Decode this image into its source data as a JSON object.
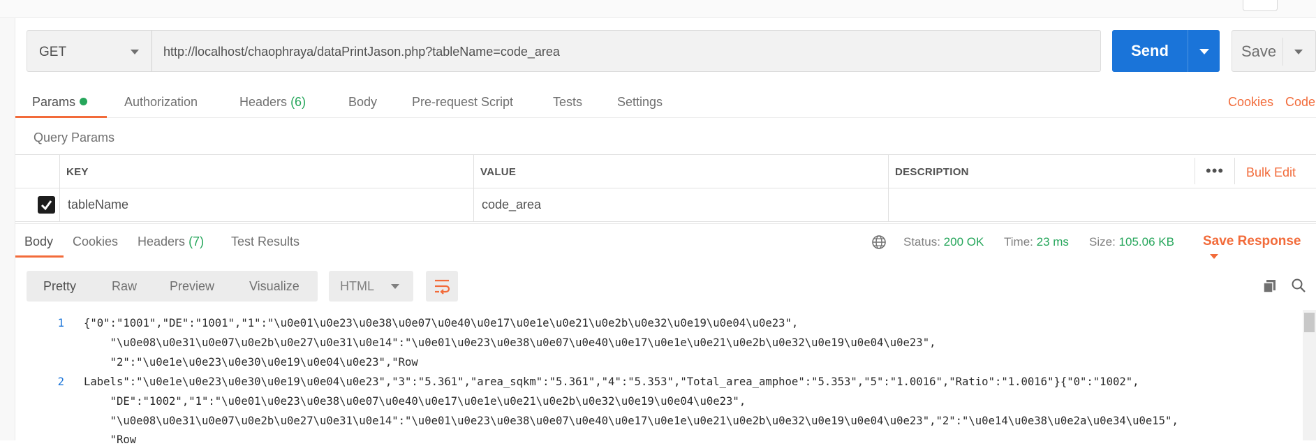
{
  "request": {
    "method": "GET",
    "url": "http://localhost/chaophraya/dataPrintJason.php?tableName=code_area",
    "send_label": "Send",
    "save_label": "Save"
  },
  "request_tabs": {
    "params": "Params",
    "authorization": "Authorization",
    "headers": "Headers",
    "headers_count": "(6)",
    "body": "Body",
    "prerequest": "Pre-request Script",
    "tests": "Tests",
    "settings": "Settings",
    "cookies": "Cookies",
    "code": "Code"
  },
  "query_params": {
    "title": "Query Params",
    "columns": {
      "key": "KEY",
      "value": "VALUE",
      "description": "DESCRIPTION"
    },
    "more": "•••",
    "bulk_edit": "Bulk Edit",
    "rows": [
      {
        "checked": true,
        "key": "tableName",
        "value": "code_area",
        "description": ""
      }
    ]
  },
  "response": {
    "tabs": {
      "body": "Body",
      "cookies": "Cookies",
      "headers": "Headers",
      "headers_count": "(7)",
      "test_results": "Test Results"
    },
    "status_label": "Status:",
    "status_value": "200 OK",
    "time_label": "Time:",
    "time_value": "23 ms",
    "size_label": "Size:",
    "size_value": "105.06 KB",
    "save_response": "Save Response",
    "view": {
      "pretty": "Pretty",
      "raw": "Raw",
      "preview": "Preview",
      "visualize": "Visualize",
      "format": "HTML"
    },
    "lines": [
      {
        "num": "1",
        "text": "{\"0\":\"1001\",\"DE\":\"1001\",\"1\":\"\\u0e01\\u0e23\\u0e38\\u0e07\\u0e40\\u0e17\\u0e1e\\u0e21\\u0e2b\\u0e32\\u0e19\\u0e04\\u0e23\","
      },
      {
        "num": "",
        "text": "    \"\\u0e08\\u0e31\\u0e07\\u0e2b\\u0e27\\u0e31\\u0e14\":\"\\u0e01\\u0e23\\u0e38\\u0e07\\u0e40\\u0e17\\u0e1e\\u0e21\\u0e2b\\u0e32\\u0e19\\u0e04\\u0e23\","
      },
      {
        "num": "",
        "text": "    \"2\":\"\\u0e1e\\u0e23\\u0e30\\u0e19\\u0e04\\u0e23\",\"Row"
      },
      {
        "num": "2",
        "text": "Labels\":\"\\u0e1e\\u0e23\\u0e30\\u0e19\\u0e04\\u0e23\",\"3\":\"5.361\",\"area_sqkm\":\"5.361\",\"4\":\"5.353\",\"Total_area_amphoe\":\"5.353\",\"5\":\"1.0016\",\"Ratio\":\"1.0016\"}{\"0\":\"1002\","
      },
      {
        "num": "",
        "text": "    \"DE\":\"1002\",\"1\":\"\\u0e01\\u0e23\\u0e38\\u0e07\\u0e40\\u0e17\\u0e1e\\u0e21\\u0e2b\\u0e32\\u0e19\\u0e04\\u0e23\","
      },
      {
        "num": "",
        "text": "    \"\\u0e08\\u0e31\\u0e07\\u0e2b\\u0e27\\u0e31\\u0e14\":\"\\u0e01\\u0e23\\u0e38\\u0e07\\u0e40\\u0e17\\u0e1e\\u0e21\\u0e2b\\u0e32\\u0e19\\u0e04\\u0e23\",\"2\":\"\\u0e14\\u0e38\\u0e2a\\u0e34\\u0e15\","
      },
      {
        "num": "",
        "text": "    \"Row"
      }
    ]
  }
}
